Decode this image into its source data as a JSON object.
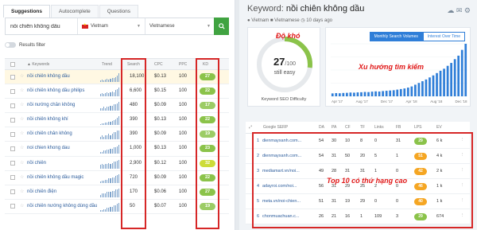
{
  "tabs": [
    "Suggestions",
    "Autocomplete",
    "Questions"
  ],
  "search": {
    "keyword_value": "nồi chiên không dầu",
    "country": "Vietnam",
    "language": "Vietnamese"
  },
  "filter_label": "Results filter",
  "table": {
    "headers": {
      "keywords": "Keywords",
      "trend": "Trend",
      "search": "Search",
      "cpc": "CPC",
      "ppc": "PPC",
      "kd": "KD"
    },
    "rows": [
      {
        "keyword": "nồi chiên không dầu",
        "trend": [
          2,
          3,
          2,
          3,
          4,
          3,
          4,
          5,
          6,
          7,
          9,
          12
        ],
        "volume": "18,100",
        "cpc": "$0.13",
        "ppc": "100",
        "kd": "27",
        "kd_color": "#8bc34a"
      },
      {
        "keyword": "nồi chiên không dầu philips",
        "trend": [
          3,
          4,
          3,
          4,
          5,
          4,
          5,
          6,
          5,
          7,
          8,
          10
        ],
        "volume": "6,600",
        "cpc": "$0.15",
        "ppc": "100",
        "kd": "22",
        "kd_color": "#8bc34a"
      },
      {
        "keyword": "nồi nướng chân không",
        "trend": [
          2,
          2,
          3,
          2,
          3,
          3,
          4,
          4,
          5,
          5,
          6,
          7
        ],
        "volume": "480",
        "cpc": "$0.09",
        "ppc": "100",
        "kd": "17",
        "kd_color": "#9ccc65"
      },
      {
        "keyword": "nồi chiên không khí",
        "trend": [
          1,
          2,
          2,
          3,
          3,
          4,
          4,
          5,
          6,
          7,
          8,
          10
        ],
        "volume": "390",
        "cpc": "$0.13",
        "ppc": "100",
        "kd": "22",
        "kd_color": "#8bc34a"
      },
      {
        "keyword": "nồi chiên chân không",
        "trend": [
          2,
          3,
          2,
          3,
          3,
          4,
          3,
          4,
          5,
          5,
          6,
          6
        ],
        "volume": "390",
        "cpc": "$0.09",
        "ppc": "100",
        "kd": "19",
        "kd_color": "#9ccc65"
      },
      {
        "keyword": "noi chien khong dau",
        "trend": [
          2,
          2,
          3,
          3,
          4,
          4,
          5,
          5,
          6,
          6,
          7,
          8
        ],
        "volume": "1,000",
        "cpc": "$0.13",
        "ppc": "100",
        "kd": "23",
        "kd_color": "#8bc34a"
      },
      {
        "keyword": "nồi chiên",
        "trend": [
          3,
          4,
          3,
          4,
          4,
          5,
          4,
          5,
          6,
          6,
          7,
          8
        ],
        "volume": "2,900",
        "cpc": "$0.12",
        "ppc": "100",
        "kd": "32",
        "kd_color": "#cddc39"
      },
      {
        "keyword": "nồi chiên không dầu magic",
        "trend": [
          1,
          2,
          2,
          3,
          3,
          4,
          4,
          5,
          5,
          6,
          7,
          8
        ],
        "volume": "720",
        "cpc": "$0.09",
        "ppc": "100",
        "kd": "22",
        "kd_color": "#8bc34a"
      },
      {
        "keyword": "nồi chiên điện",
        "trend": [
          2,
          3,
          3,
          3,
          4,
          4,
          4,
          5,
          5,
          6,
          6,
          7
        ],
        "volume": "170",
        "cpc": "$0.06",
        "ppc": "100",
        "kd": "27",
        "kd_color": "#8bc34a"
      },
      {
        "keyword": "nồi chiên nướng không dùng dầu",
        "trend": [
          1,
          1,
          2,
          2,
          3,
          3,
          4,
          4,
          5,
          5,
          6,
          7
        ],
        "volume": "50",
        "cpc": "$0.07",
        "ppc": "100",
        "kd": "19",
        "kd_color": "#9ccc65"
      }
    ]
  },
  "right": {
    "title_prefix": "Keyword:",
    "title_keyword": "nồi chiên không dầu",
    "meta": "● Vietnam   ■ Vietnamese   ◷ 10 days ago",
    "kd_value": "27",
    "kd_max": "/100",
    "kd_label": "still easy",
    "kd_footer": "Keyword SEO Difficulty",
    "annotation_kd": "Độ khó",
    "annotation_trend": "Xu hướng tìm kiếm",
    "annotation_top10": "Top 10 có thứ hạng cao",
    "chart_tabs": [
      "Monthly Search Volumes",
      "Interest Over Time"
    ],
    "serp_headers": {
      "serp": "Google SERP",
      "da": "DA",
      "pa": "PA",
      "cf": "CF",
      "tf": "TF",
      "links": "Links",
      "fb": "FB",
      "lps": "LPS",
      "ev": "EV"
    },
    "serp_rows": [
      {
        "rank": "1",
        "url": "dienmayxanh.com...",
        "da": "54",
        "pa": "30",
        "cf": "10",
        "tf": "8",
        "links": "0",
        "fb": "31",
        "lps": "29",
        "lps_color": "#8bc34a",
        "ev": "6 k"
      },
      {
        "rank": "2",
        "url": "dienmayxanh.com...",
        "da": "54",
        "pa": "31",
        "cf": "50",
        "tf": "20",
        "links": "5",
        "fb": "1",
        "lps": "51",
        "lps_color": "#f5a623",
        "ev": "4 k"
      },
      {
        "rank": "3",
        "url": "mediamart.vn/noi...",
        "da": "49",
        "pa": "28",
        "cf": "31",
        "tf": "31",
        "links": "1",
        "fb": "0",
        "lps": "42",
        "lps_color": "#f5a623",
        "ev": "2 k"
      },
      {
        "rank": "4",
        "url": "adayroi.com/noi...",
        "da": "56",
        "pa": "31",
        "cf": "29",
        "tf": "25",
        "links": "2",
        "fb": "0",
        "lps": "46",
        "lps_color": "#f5a623",
        "ev": "1 k"
      },
      {
        "rank": "5",
        "url": "meta.vn/noi-chien...",
        "da": "51",
        "pa": "31",
        "cf": "19",
        "tf": "29",
        "links": "0",
        "fb": "0",
        "lps": "40",
        "lps_color": "#f5a623",
        "ev": "1 k"
      },
      {
        "rank": "6",
        "url": "chonmuachuan.c...",
        "da": "26",
        "pa": "21",
        "cf": "16",
        "tf": "1",
        "links": "109",
        "fb": "3",
        "lps": "29",
        "lps_color": "#8bc34a",
        "ev": "674"
      }
    ]
  },
  "chart_data": {
    "type": "bar",
    "title": "",
    "series": [
      {
        "values": [
          1.0,
          1.1,
          1.05,
          1.15,
          1.2,
          1.3,
          1.25,
          1.35,
          1.4,
          1.5,
          1.45,
          1.6,
          1.7,
          1.65,
          1.8,
          1.9,
          2.0,
          2.1,
          2.3,
          2.5,
          2.7,
          3.0,
          3.4,
          4.0,
          4.6,
          5.2,
          5.8,
          6.5,
          7.2,
          8.0,
          8.8,
          9.5,
          10.5,
          11.5,
          12.8,
          14.0,
          16.0,
          18.1
        ]
      }
    ],
    "x_tick_labels": [
      "Apr '17",
      "Aug '17",
      "Dec '17",
      "Apr '18",
      "Aug '18",
      "Dec '18"
    ],
    "grid": true
  },
  "colors": {
    "accent_green": "#40a341",
    "link_blue": "#2d5d9c",
    "annotation_red": "#d62727",
    "kd_gauge": "#8bc34a",
    "bar_blue": "#2f7ed8"
  }
}
